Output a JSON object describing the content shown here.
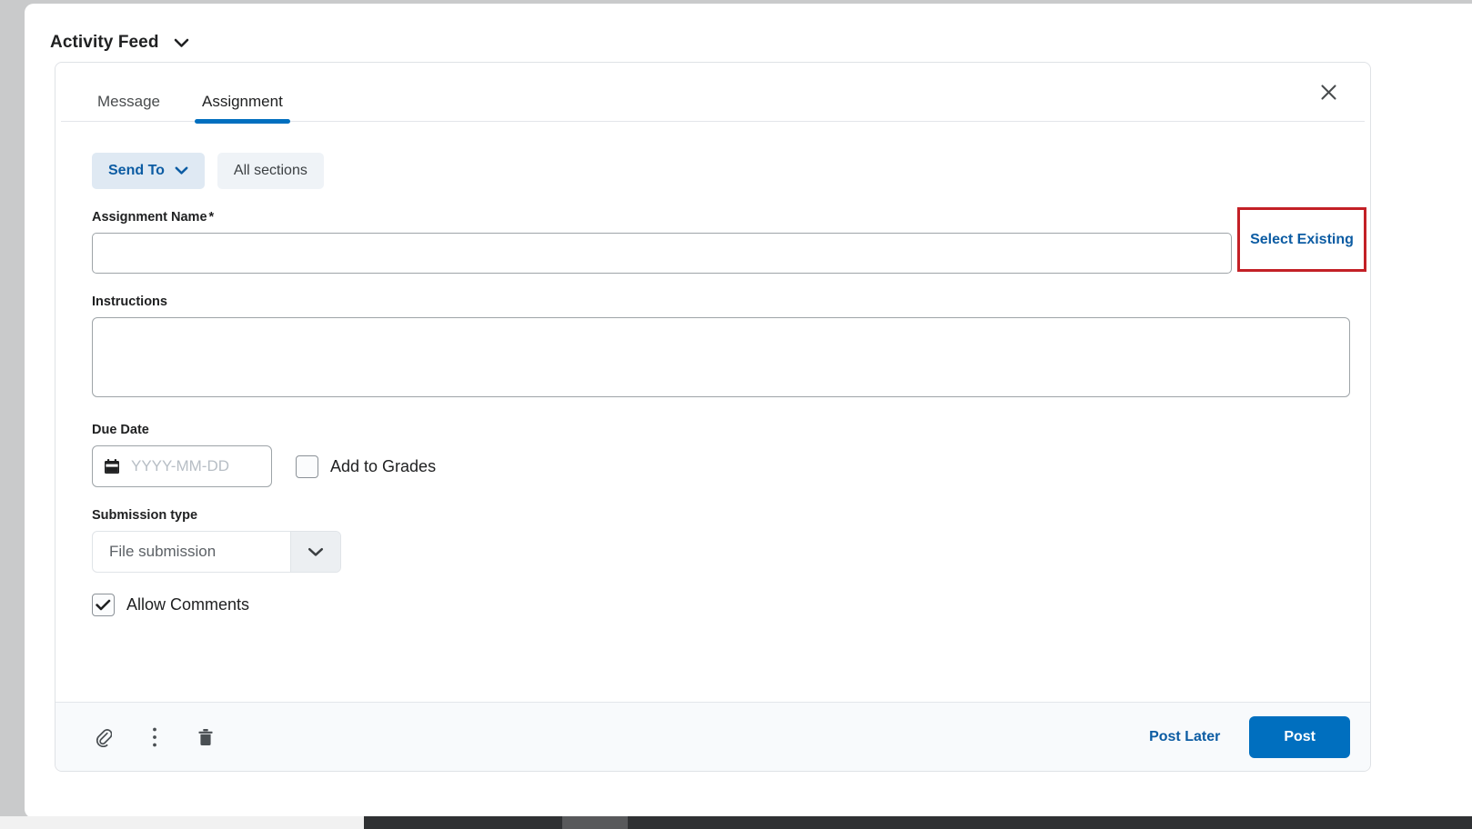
{
  "header": {
    "title": "Activity Feed",
    "dropdown_icon": "chevron-down-icon"
  },
  "composer": {
    "tabs": [
      {
        "label": "Message",
        "active": false
      },
      {
        "label": "Assignment",
        "active": true
      }
    ],
    "close_icon": "close-icon",
    "accent_color": "#006fbf",
    "send_to": {
      "button_label": "Send To",
      "chevron_icon": "chevron-down-icon",
      "chip_label": "All sections"
    },
    "assignment_name": {
      "label": "Assignment Name",
      "required_marker": "*",
      "value": "",
      "placeholder": ""
    },
    "select_existing": {
      "label": "Select Existing",
      "highlight_color": "#c32026",
      "link_color": "#0c5ca3"
    },
    "instructions": {
      "label": "Instructions",
      "value": "",
      "placeholder": ""
    },
    "due_date": {
      "label": "Due Date",
      "calendar_icon": "calendar-icon",
      "value": "",
      "placeholder": "YYYY-MM-DD"
    },
    "add_to_grades": {
      "label": "Add to Grades",
      "checked": false
    },
    "submission_type": {
      "label": "Submission type",
      "selected": "File submission",
      "chevron_icon": "chevron-down-icon",
      "options": [
        "File submission"
      ]
    },
    "allow_comments": {
      "label": "Allow Comments",
      "checked": true,
      "check_icon": "checkmark-icon"
    },
    "footer": {
      "attach_icon": "paperclip-icon",
      "more_icon": "more-vertical-icon",
      "delete_icon": "trash-icon",
      "post_later_label": "Post Later",
      "post_label": "Post"
    }
  }
}
